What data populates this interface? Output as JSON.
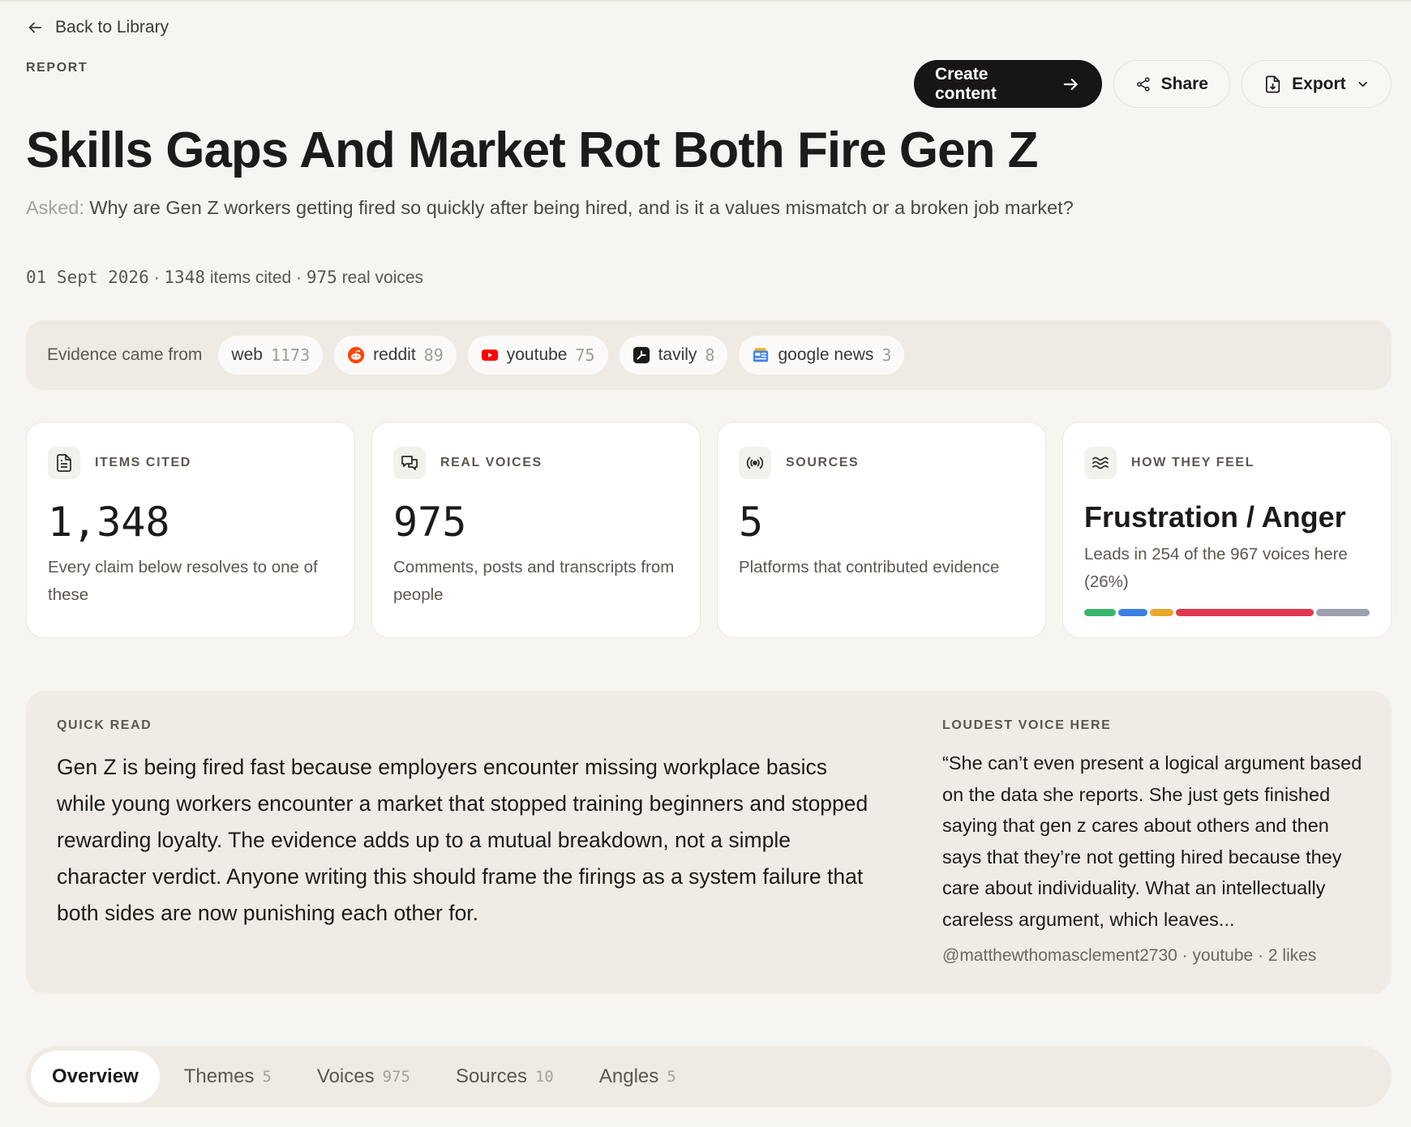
{
  "nav": {
    "back_label": "Back to Library"
  },
  "report": {
    "kicker": "REPORT",
    "title": "Skills Gaps And Market Rot Both Fire Gen Z",
    "asked_label": "Asked:",
    "asked_text": " Why are Gen Z workers getting fired so quickly after being hired, and is it a values mismatch or a broken job market?",
    "date": "01 Sept 2026",
    "items_count": "1348",
    "items_label": "items cited",
    "voices_count": "975",
    "voices_label": "real voices",
    "separator": "·"
  },
  "actions": {
    "create_label": "Create content",
    "share_label": "Share",
    "export_label": "Export"
  },
  "evidence": {
    "label": "Evidence came from",
    "sources": [
      {
        "name": "web",
        "count": "1173"
      },
      {
        "name": "reddit",
        "count": "89"
      },
      {
        "name": "youtube",
        "count": "75"
      },
      {
        "name": "tavily",
        "count": "8"
      },
      {
        "name": "google news",
        "count": "3"
      }
    ]
  },
  "stats": [
    {
      "label": "ITEMS CITED",
      "value": "1,348",
      "desc": "Every claim below resolves to one of these",
      "icon": "document-icon"
    },
    {
      "label": "REAL VOICES",
      "value": "975",
      "desc": "Comments, posts and transcripts from people",
      "icon": "chat-bubbles-icon"
    },
    {
      "label": "SOURCES",
      "value": "5",
      "desc": "Platforms that contributed evidence",
      "icon": "broadcast-icon"
    },
    {
      "label": "HOW THEY FEEL",
      "value": "Frustration / Anger",
      "desc": "Leads in 254 of the 967 voices here (26%)",
      "icon": "waves-icon"
    }
  ],
  "emotion_bar": [
    {
      "color": "#3bb56b",
      "share": 0.115
    },
    {
      "color": "#3d7fe0",
      "share": 0.105
    },
    {
      "color": "#e9a72b",
      "share": 0.085
    },
    {
      "color": "#e0384f",
      "share": 0.5
    },
    {
      "color": "#9aa1ae",
      "share": 0.195
    }
  ],
  "quick_read": {
    "label": "QUICK READ",
    "text": "Gen Z is being fired fast because employers encounter missing workplace basics while young workers encounter a market that stopped training beginners and stopped rewarding loyalty. The evidence adds up to a mutual breakdown, not a simple character verdict. Anyone writing this should frame the firings as a system failure that both sides are now punishing each other for."
  },
  "loudest_voice": {
    "label": "LOUDEST VOICE HERE",
    "quote": "“She can’t even present a logical argument based on the data she reports. She just gets finished saying that gen z cares about others and then says that they’re not getting hired because they care about individuality. What an intellectually careless argument, which leaves...",
    "author": "@matthewthomasclement2730",
    "platform": "youtube",
    "likes": "2 likes"
  },
  "tabs": [
    {
      "label": "Overview",
      "count": ""
    },
    {
      "label": "Themes",
      "count": "5"
    },
    {
      "label": "Voices",
      "count": "975"
    },
    {
      "label": "Sources",
      "count": "10"
    },
    {
      "label": "Angles",
      "count": "5"
    }
  ]
}
